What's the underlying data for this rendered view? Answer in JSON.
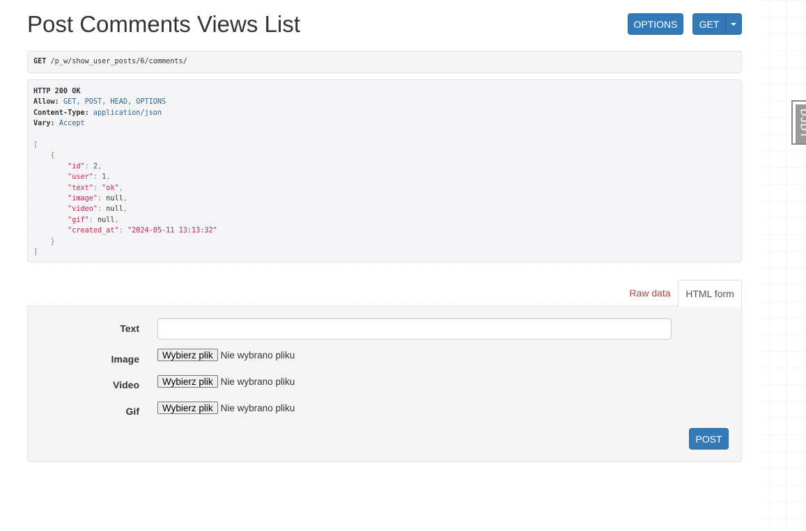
{
  "page": {
    "title": "Post Comments Views List"
  },
  "toolbar": {
    "options_label": "OPTIONS",
    "get_label": "GET"
  },
  "request": {
    "method": "GET",
    "path": "/p_w/show_user_posts/6/comments/"
  },
  "response": {
    "status_line": "HTTP 200 OK",
    "headers": [
      {
        "name": "Allow:",
        "value": "GET, POST, HEAD, OPTIONS"
      },
      {
        "name": "Content-Type:",
        "value": "application/json"
      },
      {
        "name": "Vary:",
        "value": "Accept"
      }
    ],
    "body_items": [
      {
        "fields": [
          {
            "key": "\"id\"",
            "value": "2",
            "type": "num"
          },
          {
            "key": "\"user\"",
            "value": "1",
            "type": "num"
          },
          {
            "key": "\"text\"",
            "value": "\"ok\"",
            "type": "str"
          },
          {
            "key": "\"image\"",
            "value": "null",
            "type": "nul"
          },
          {
            "key": "\"video\"",
            "value": "null",
            "type": "nul"
          },
          {
            "key": "\"gif\"",
            "value": "null",
            "type": "nul"
          },
          {
            "key": "\"created_at\"",
            "value": "\"2024-05-11 13:13:32\"",
            "type": "str"
          }
        ]
      }
    ]
  },
  "tabs": {
    "raw_label": "Raw data",
    "html_label": "HTML form"
  },
  "form": {
    "text_label": "Text",
    "text_value": "",
    "image_label": "Image",
    "video_label": "Video",
    "gif_label": "Gif",
    "file_button_label": "Wybierz plik",
    "file_status": "Nie wybrano pliku",
    "submit_label": "POST"
  },
  "badge": {
    "text": "DJDT"
  },
  "colors": {
    "primary": "#337ab7",
    "raw_tab": "#a94442",
    "json_string": "#c7254e"
  }
}
